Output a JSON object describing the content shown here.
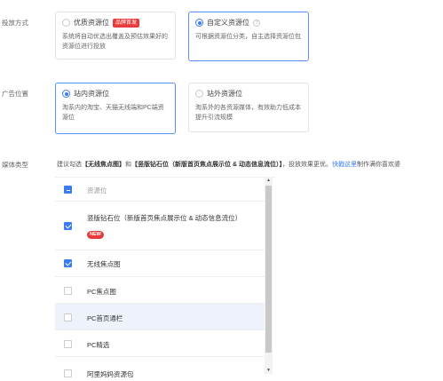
{
  "bid_method": {
    "label": "投放方式",
    "options": [
      {
        "title": "优质资源位",
        "badge": "品牌首发",
        "desc": "系统将自动优选出覆盖及预估效果好的资源位进行投放",
        "selected": false
      },
      {
        "title": "自定义资源位",
        "desc": "可根据资源位分类，自主选择资源位包",
        "selected": true
      }
    ]
  },
  "ad_position": {
    "label": "广告位置",
    "options": [
      {
        "title": "站内资源位",
        "desc": "淘系内的淘宝、天猫无线端和PC端资源位",
        "selected": true
      },
      {
        "title": "站外资源位",
        "desc": "淘系外的各资源媒体，有效助力低成本提升引流规模",
        "selected": false
      }
    ]
  },
  "media_type": {
    "label": "媒体类型",
    "hint_prefix": "建议勾选",
    "hint_b1": "【无线焦点图】",
    "hint_and": "和",
    "hint_b2": "【竖版钻石位（新版首页焦点展示位 & 动态信息流位）】",
    "hint_suffix": "，投放效果更优。",
    "hint_link": "快戳这里",
    "hint_tail": "制作满你喜欢婆",
    "list": [
      {
        "label": "资源位",
        "state": "indeterminate",
        "muted": true
      },
      {
        "label": "竖版钻石位（新版首页焦点展示位 & 动态信息流位）",
        "state": "checked",
        "badge": "NEW"
      },
      {
        "label": "无线焦点图",
        "state": "checked"
      },
      {
        "label": "PC焦点图",
        "state": "unchecked"
      },
      {
        "label": "PC首页通栏",
        "state": "unchecked",
        "hover": true
      },
      {
        "label": "PC精选",
        "state": "unchecked"
      },
      {
        "label": "阿里妈妈资源包",
        "state": "unchecked"
      }
    ]
  },
  "colors": {
    "accent": "#3b7cf6",
    "badge": "#e83c3c",
    "hover_row": "#eef3fb"
  },
  "icons": {
    "scroll_up": "triangle-up-icon",
    "scroll_down": "triangle-down-icon",
    "help": "help-circle-icon"
  }
}
